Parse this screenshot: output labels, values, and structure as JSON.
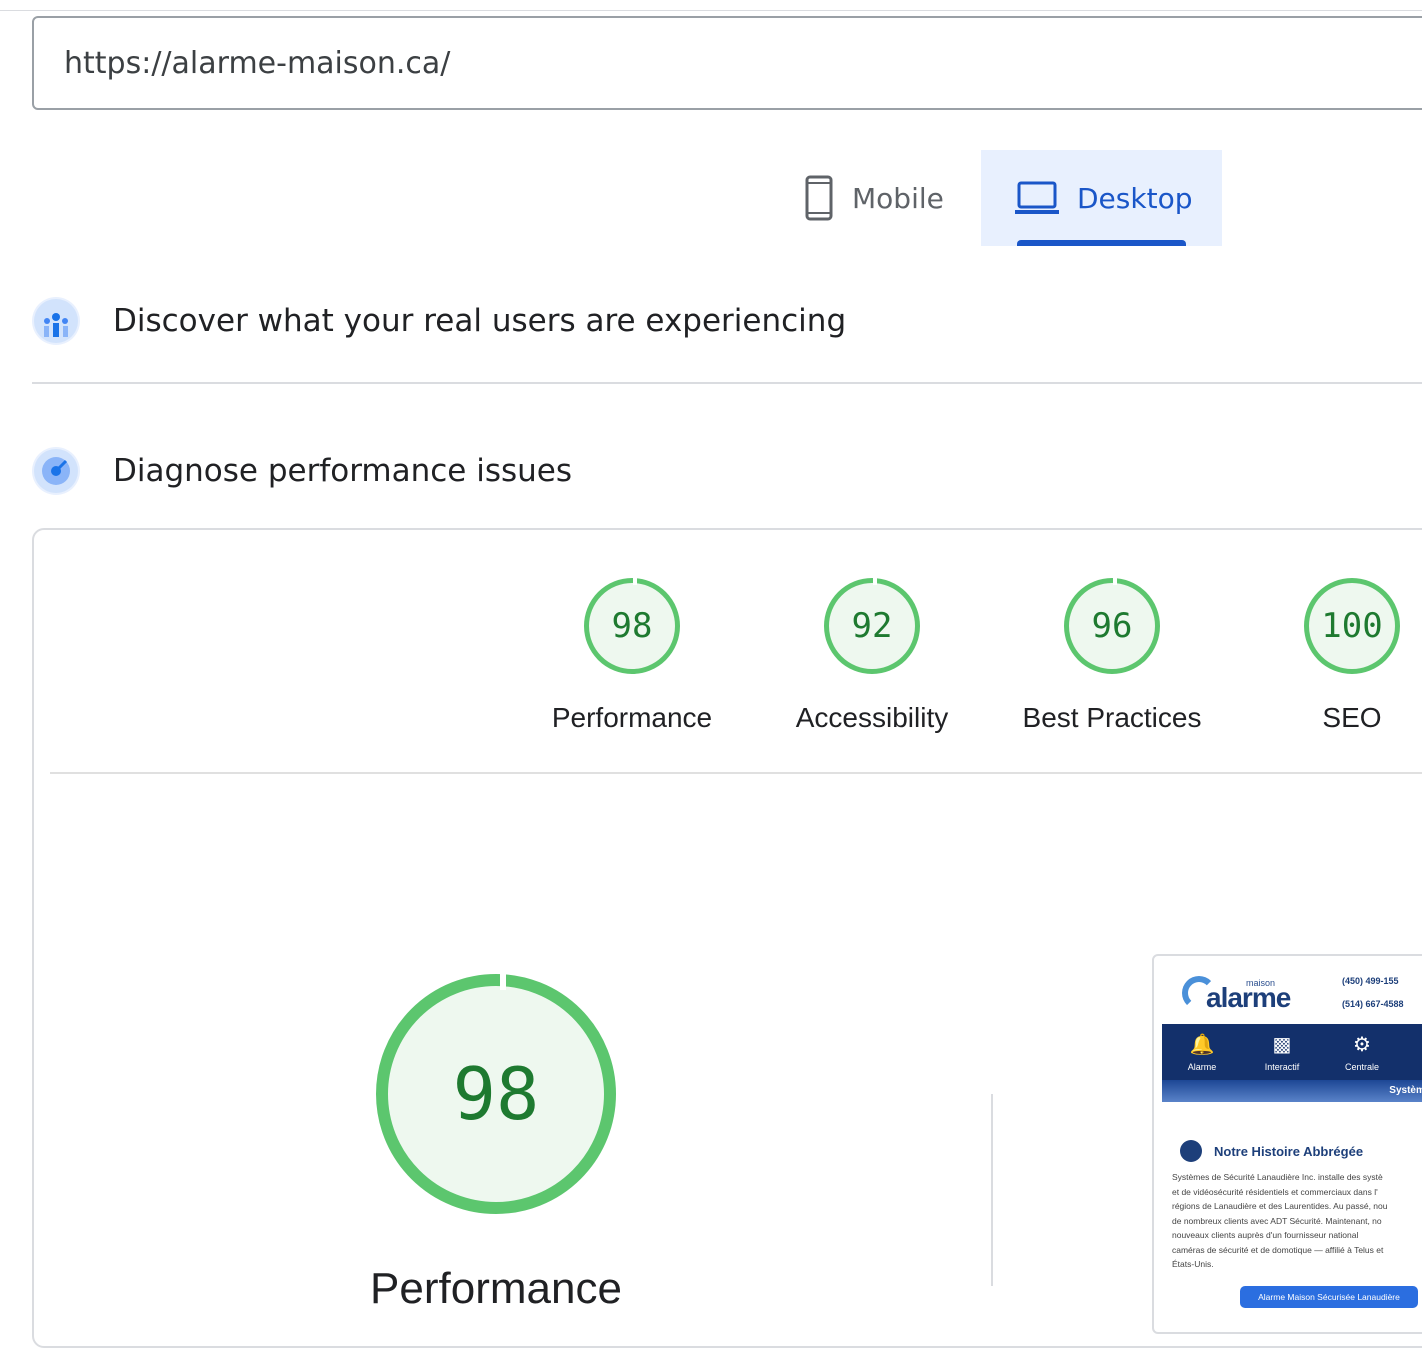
{
  "url_input": {
    "value": "https://alarme-maison.ca/"
  },
  "device_tabs": {
    "mobile": "Mobile",
    "desktop": "Desktop",
    "selected": "desktop"
  },
  "sections": {
    "real_users": "Discover what your real users are experiencing",
    "diagnose": "Diagnose performance issues"
  },
  "scores": [
    {
      "label": "Performance",
      "value": "98"
    },
    {
      "label": "Accessibility",
      "value": "92"
    },
    {
      "label": "Best Practices",
      "value": "96"
    },
    {
      "label": "SEO",
      "value": "100"
    }
  ],
  "main_score": {
    "label": "Performance",
    "value": "98"
  },
  "score_color": "#5cc66e",
  "screenshot": {
    "logo_small": "maison",
    "logo": "alarme",
    "phone_1": "(450) 499-155",
    "phone_2": "(514) 667-4588",
    "nav": [
      "Alarme",
      "Interactif",
      "Centrale"
    ],
    "band": "Systèmes",
    "history_title": "Notre Histoire Abbrégée",
    "history_lines": [
      "Systèmes de Sécurité Lanaudière Inc. installe des systè",
      "et de vidéosécurité résidentiels et commerciaux dans l'",
      "régions de Lanaudière et des Laurentides. Au passé, nou",
      "de nombreux clients avec ADT Sécurité. Maintenant, no",
      "nouveaux clients auprès d'un fournisseur national",
      "caméras de sécurité et de domotique — affilié à Telus et",
      "États-Unis."
    ],
    "cta": "Alarme Maison Sécurisée Lanaudière"
  }
}
